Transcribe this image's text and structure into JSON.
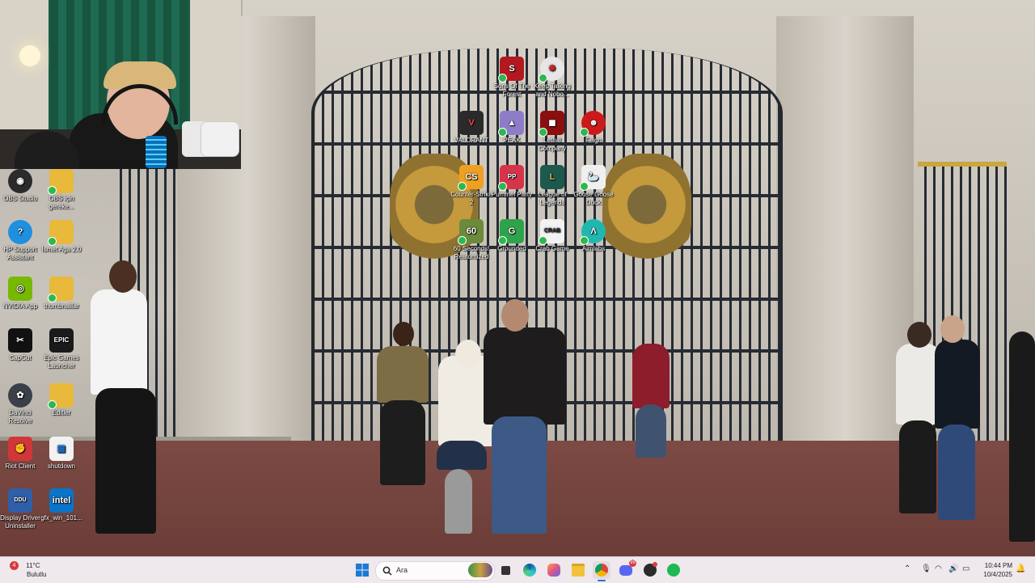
{
  "desktop_icons_left": [
    {
      "label": "OBS Studio",
      "icon": "obs-icon",
      "color": "#2b2b2b"
    },
    {
      "label": "OBS için gereke...",
      "icon": "folder-icon",
      "color": "#e8b93a"
    },
    {
      "label": "HP Support Assistant",
      "icon": "hp-support-icon",
      "color": "#1f8fe0"
    },
    {
      "label": "İsmet Aga 2.0",
      "icon": "folder-icon",
      "color": "#e8b93a"
    },
    {
      "label": "NVIDIA App",
      "icon": "nvidia-icon",
      "color": "#76b900"
    },
    {
      "label": "thumbnaillar",
      "icon": "folder-icon",
      "color": "#e8b93a"
    },
    {
      "label": "CapCut",
      "icon": "capcut-icon",
      "color": "#111111"
    },
    {
      "label": "Epic Games Launcher",
      "icon": "epic-games-icon",
      "color": "#1a1a1a"
    },
    {
      "label": "DaVinci Resolve",
      "icon": "davinci-icon",
      "color": "#3a3f4a"
    },
    {
      "label": "Editler",
      "icon": "folder-icon",
      "color": "#e8b93a"
    },
    {
      "label": "Riot Client",
      "icon": "riot-icon",
      "color": "#d13639"
    },
    {
      "label": "shutdown",
      "icon": "shutdown-file-icon",
      "color": "#f2f2f2"
    },
    {
      "label": "Display Driver Uninstaller",
      "icon": "ddu-icon",
      "color": "#2f5fa8"
    },
    {
      "label": "gfx_win_101...",
      "icon": "intel-icon",
      "color": "#0a74c9"
    }
  ],
  "desktop_icons_center": [
    {
      "label": "Sons Of The Forest",
      "icon": "sons-forest-icon",
      "color": "#b3191e"
    },
    {
      "label": "Keep Talking and Nobo...",
      "icon": "keep-talking-icon",
      "color": "#e6e6e6"
    },
    {
      "label": "VALORANT",
      "icon": "valorant-icon",
      "color": "#2a2a2a"
    },
    {
      "label": "PEAK",
      "icon": "peak-icon",
      "color": "#8d7dc9"
    },
    {
      "label": "Lethal Company",
      "icon": "lethal-company-icon",
      "color": "#8b0f0f"
    },
    {
      "label": "Feign",
      "icon": "feign-icon",
      "color": "#cc1a1a"
    },
    {
      "label": "Counter-Strike 2",
      "icon": "cs2-icon",
      "color": "#f0a020"
    },
    {
      "label": "Pummel Party",
      "icon": "pummel-party-icon",
      "color": "#d6344a"
    },
    {
      "label": "League of Legends",
      "icon": "lol-icon",
      "color": "#1d5a4d"
    },
    {
      "label": "Goose Goose Duck",
      "icon": "goose-duck-icon",
      "color": "#f0f0f0"
    },
    {
      "label": "60 Seconds! Reatomized",
      "icon": "sixty-seconds-icon",
      "color": "#6b8a3a"
    },
    {
      "label": "Grounded",
      "icon": "grounded-icon",
      "color": "#2fa34c"
    },
    {
      "label": "Crab Game",
      "icon": "crab-game-icon",
      "color": "#f2f2f2"
    },
    {
      "label": "Aimlabs",
      "icon": "aimlabs-icon",
      "color": "#1fb8b0"
    }
  ],
  "taskbar": {
    "weather_temp": "11°C",
    "weather_desc": "Bulutlu",
    "weather_badge": "4",
    "search_placeholder": "Ara",
    "clock_time": "10:44 PM",
    "clock_date": "10/4/2025",
    "discord_badge": "99"
  }
}
